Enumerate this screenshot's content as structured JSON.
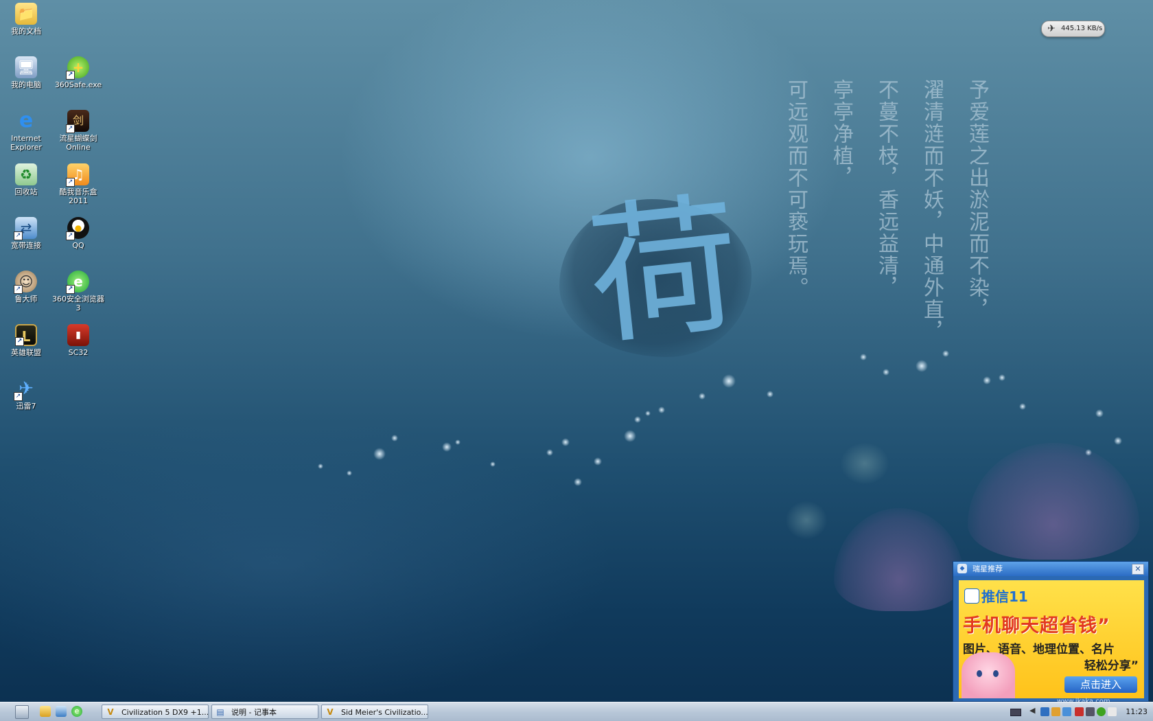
{
  "desktop": {
    "icons": [
      {
        "label": "我的文档",
        "icon": "folder-docs-icon"
      },
      {
        "label": "我的电脑",
        "icon": "my-computer-icon"
      },
      {
        "label": "360Safe.exe",
        "icon": "360safe-icon"
      },
      {
        "label": "Internet Explorer",
        "icon": "ie-icon"
      },
      {
        "label": "流星蝴蝶剑Online",
        "icon": "game-sword-icon"
      },
      {
        "label": "回收站",
        "icon": "recycle-bin-icon"
      },
      {
        "label": "酷我音乐盒2011",
        "icon": "kuwo-music-icon"
      },
      {
        "label": "宽带连接",
        "icon": "broadband-icon"
      },
      {
        "label": "QQ",
        "icon": "qq-penguin-icon"
      },
      {
        "label": "鲁大师",
        "icon": "ludashi-icon"
      },
      {
        "label": "360安全浏览器 3",
        "icon": "360-browser-icon"
      },
      {
        "label": "英雄联盟",
        "icon": "lol-icon"
      },
      {
        "label": "SC32",
        "icon": "sc32-icon"
      },
      {
        "label": "迅雷7",
        "icon": "xunlei-bird-icon"
      }
    ]
  },
  "wallpaper": {
    "character": "荷",
    "poem_columns": [
      "予爱莲之出淤泥而不染，",
      "濯清涟而不妖，中通外直，",
      "不蔓不枝，香远益清，",
      "亭亭净植，",
      "可远观而不可亵玩焉。"
    ]
  },
  "netspeed": {
    "value": "445.13 KB/s"
  },
  "popup": {
    "title": "瑞星推荐",
    "close_symbol": "✕",
    "ad": {
      "brand": "推信11",
      "headline": "手机聊天超省钱”",
      "subline": "图片、语音、地理位置、名片",
      "share": "轻松分享”",
      "button": "点击进入"
    }
  },
  "taskbar": {
    "tasks": [
      {
        "label": "Civilization 5 DX9 +1..."
      },
      {
        "label": "说明 - 记事本"
      },
      {
        "label": "Sid Meier's Civilizatio..."
      }
    ],
    "clock": "11:23"
  },
  "watermark": "www.ikaka.com"
}
